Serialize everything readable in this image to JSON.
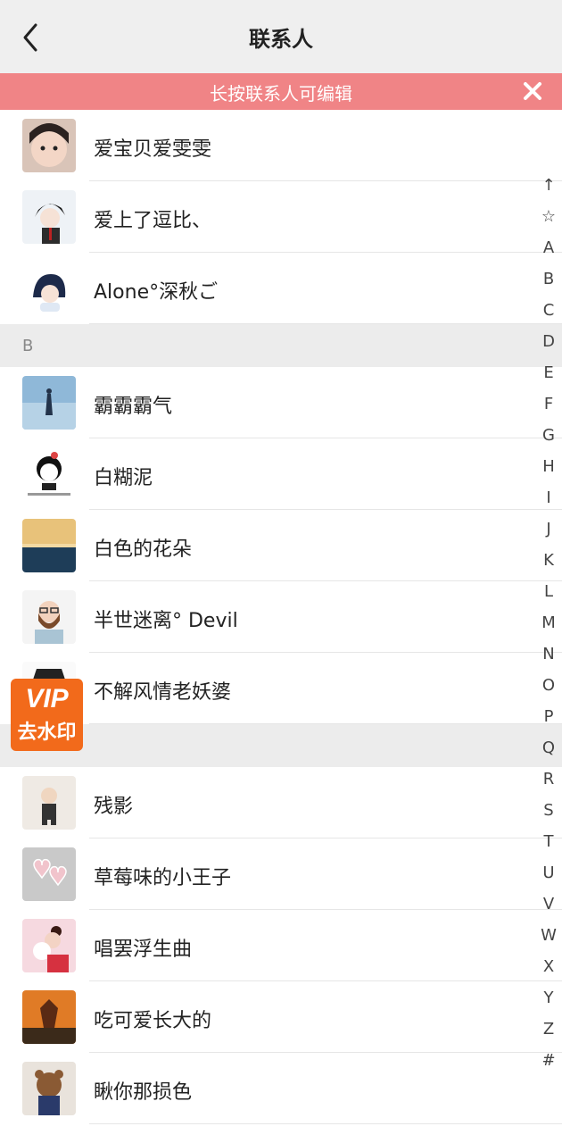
{
  "header": {
    "title": "联系人"
  },
  "banner": {
    "text": "长按联系人可编辑"
  },
  "groups": [
    {
      "letter": "A",
      "label_visible": false,
      "contacts": [
        {
          "name": "爱宝贝爱雯雯",
          "avatar": "girl-face-photo"
        },
        {
          "name": "爱上了逗比、",
          "avatar": "anime-boy"
        },
        {
          "name": "Alone°深秋ご",
          "avatar": "cartoon-girl"
        }
      ]
    },
    {
      "letter": "B",
      "label_visible": true,
      "contacts": [
        {
          "name": "霸霸霸气",
          "avatar": "silhouette-sky"
        },
        {
          "name": "白糊泥",
          "avatar": "cartoon-kid"
        },
        {
          "name": "白色的花朵",
          "avatar": "ocean-sunset"
        },
        {
          "name": "半世迷离°  Devil",
          "avatar": "bearded-man"
        },
        {
          "name": "不解风情老妖婆",
          "avatar": "comic-face"
        }
      ]
    },
    {
      "letter": "C",
      "label_visible": false,
      "contacts": [
        {
          "name": "残影",
          "avatar": "cartoon-figure"
        },
        {
          "name": "草莓味的小王子",
          "avatar": "heart-earrings"
        },
        {
          "name": "唱罢浮生曲",
          "avatar": "girl-with-dog"
        },
        {
          "name": "吃可爱长大的",
          "avatar": "boat-sunset"
        },
        {
          "name": "瞅你那损色",
          "avatar": "bear-costume"
        }
      ]
    }
  ],
  "index": [
    "↑",
    "☆",
    "A",
    "B",
    "C",
    "D",
    "E",
    "F",
    "G",
    "H",
    "I",
    "J",
    "K",
    "L",
    "M",
    "N",
    "O",
    "P",
    "Q",
    "R",
    "S",
    "T",
    "U",
    "V",
    "W",
    "X",
    "Y",
    "Z",
    "#"
  ],
  "vip_badge": {
    "line1": "VIP",
    "line2": "去水印"
  },
  "colors": {
    "banner": "#f08486",
    "header": "#efefef",
    "section": "#ececec",
    "vip": "#f26a1b"
  }
}
